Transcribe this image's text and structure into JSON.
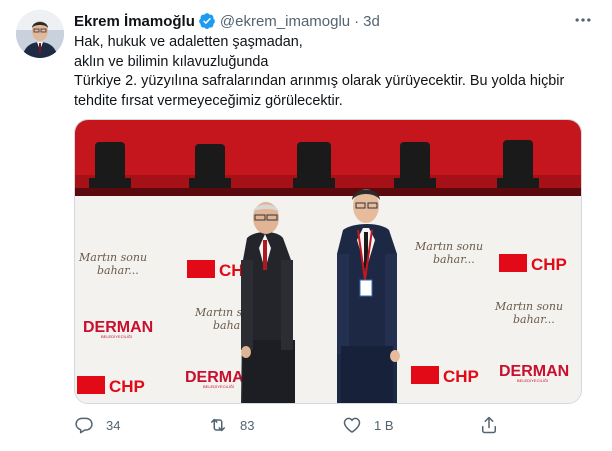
{
  "user": {
    "name": "Ekrem İmamoğlu",
    "handle": "@ekrem_imamoglu",
    "separator": "·",
    "time": "3d"
  },
  "tweet": {
    "lines": [
      "Hak, hukuk ve adaletten şaşmadan,",
      "aklın ve bilimin kılavuzluğunda",
      "Türkiye 2. yüzyılına safralarından arınmış olarak yürüyecektir. Bu yolda hiçbir",
      "tehdite fırsat vermeyeceğimiz görülecektir."
    ]
  },
  "media": {
    "backdrop_texts": {
      "martin_line1": "Martın sonu",
      "martin_line2": "bahar...",
      "chp": "CHP",
      "derman": "DERMAN",
      "derman_sub": "BELEDİYECİLİĞİ"
    }
  },
  "actions": {
    "reply_count": "34",
    "retweet_count": "83",
    "like_count": "1 B",
    "icons": [
      "reply-icon",
      "retweet-icon",
      "like-icon",
      "share-icon"
    ]
  },
  "colors": {
    "verified": "#1d9bf0",
    "muted": "#536471",
    "stage_red": "#c4161c",
    "chp_red": "#e30a17",
    "derman_red": "#c8102e"
  }
}
